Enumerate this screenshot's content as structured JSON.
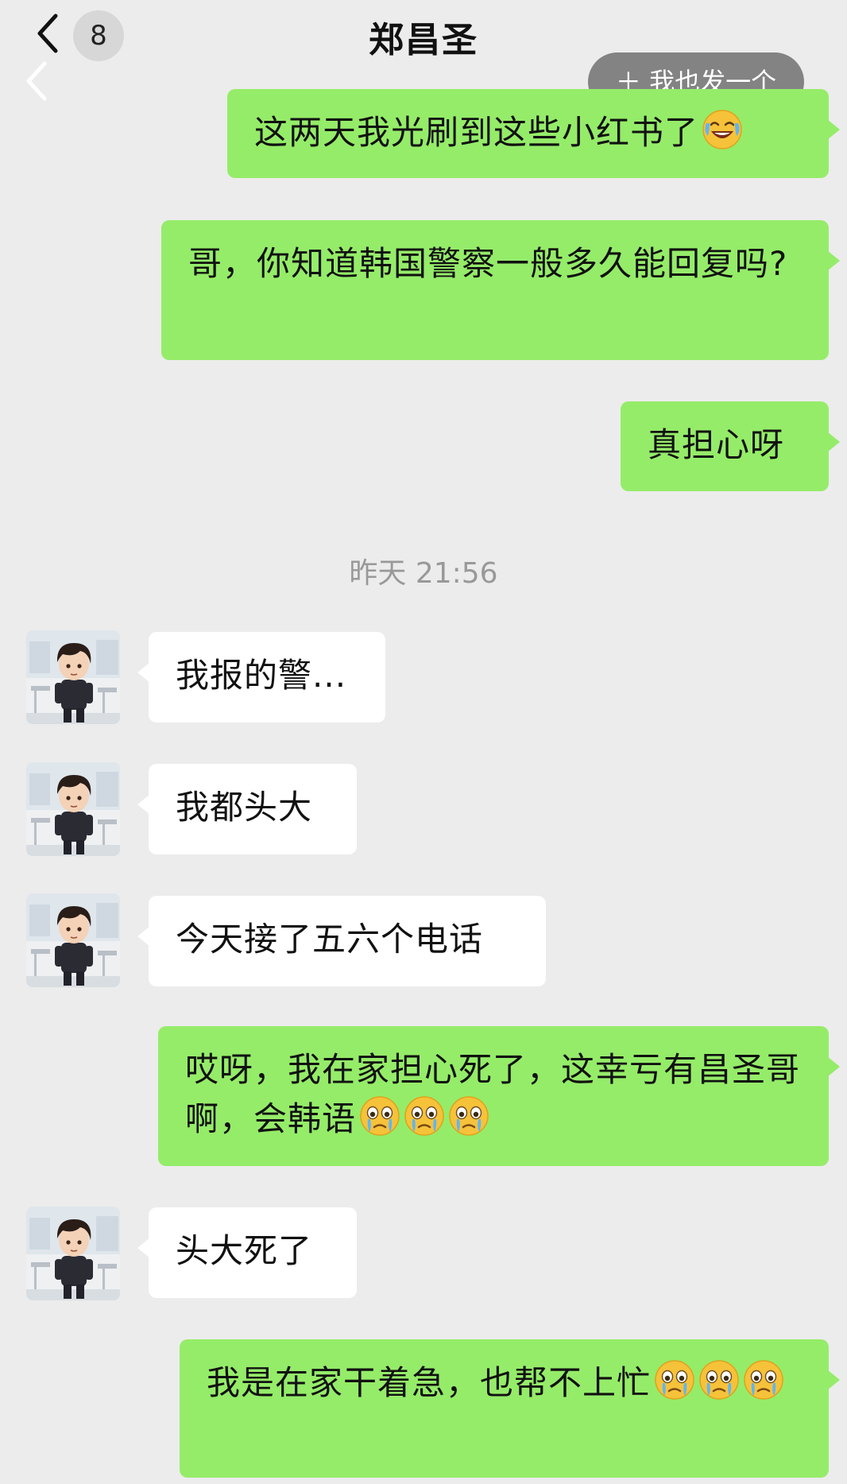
{
  "header": {
    "badge_count": "8",
    "title": "郑昌圣",
    "send_one_label": "＋ 我也发一个"
  },
  "messages": [
    {
      "text": "这两天我光刷到这些小红书了"
    },
    {
      "text": "哥，你知道韩国警察一般多久能回复吗?"
    },
    {
      "text": "真担心呀"
    },
    {
      "text": "我报的警..."
    },
    {
      "text": "我都头大"
    },
    {
      "text": "今天接了五六个电话"
    },
    {
      "text": "哎呀，我在家担心死了，这幸亏有昌圣哥啊，会韩语"
    },
    {
      "text": "头大死了"
    },
    {
      "text": "我是在家干着急，也帮不上忙"
    }
  ],
  "timestamp": "昨天 21:56",
  "icons": {
    "back": "chevron-left-icon",
    "laugh_cry": "rolling-laughing-emoji",
    "crying": "crying-face-emoji"
  },
  "colors": {
    "background": "#ececec",
    "outgoing_bubble": "#95ec69",
    "incoming_bubble": "#ffffff",
    "timestamp_text": "#999999"
  }
}
